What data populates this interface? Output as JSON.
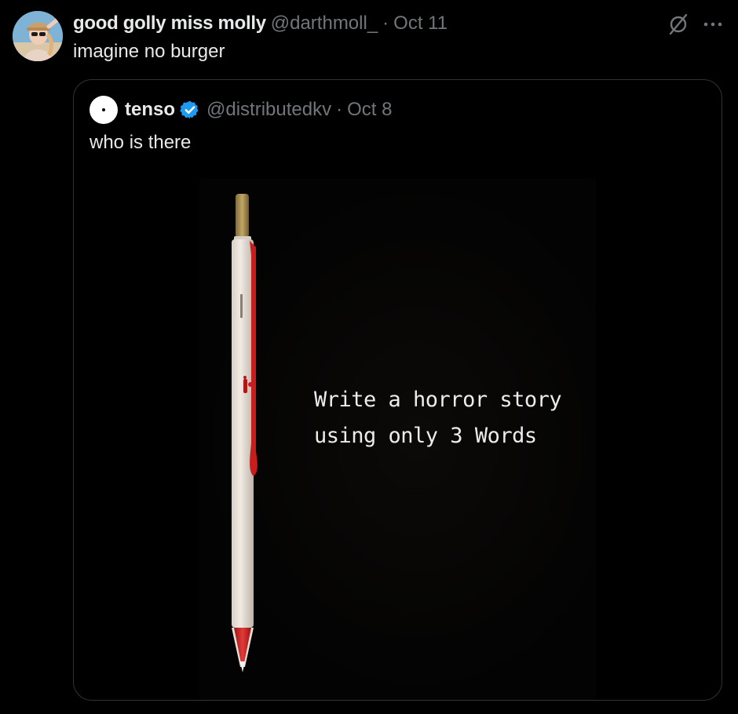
{
  "tweet": {
    "author": {
      "display_name": "good golly miss molly",
      "handle": "@darthmoll_",
      "separator": "·",
      "date": "Oct 11"
    },
    "text": "imagine no burger",
    "icons": {
      "grok": "grok-slash-circle-icon",
      "more": "more-dots-icon"
    }
  },
  "quote": {
    "author": {
      "display_name": "tenso",
      "handle": "@distributedkv",
      "separator": "·",
      "date": "Oct 8",
      "verified": true
    },
    "text": "who is there",
    "media": {
      "caption_line_1": "Write a horror story",
      "caption_line_2": "using only 3 Words"
    }
  },
  "colors": {
    "background": "#000000",
    "primary_text": "#e7e9ea",
    "secondary_text": "#71767b",
    "border": "#2f3336",
    "verified_blue": "#1d9bf0",
    "pencil_red": "#c81d1d"
  }
}
